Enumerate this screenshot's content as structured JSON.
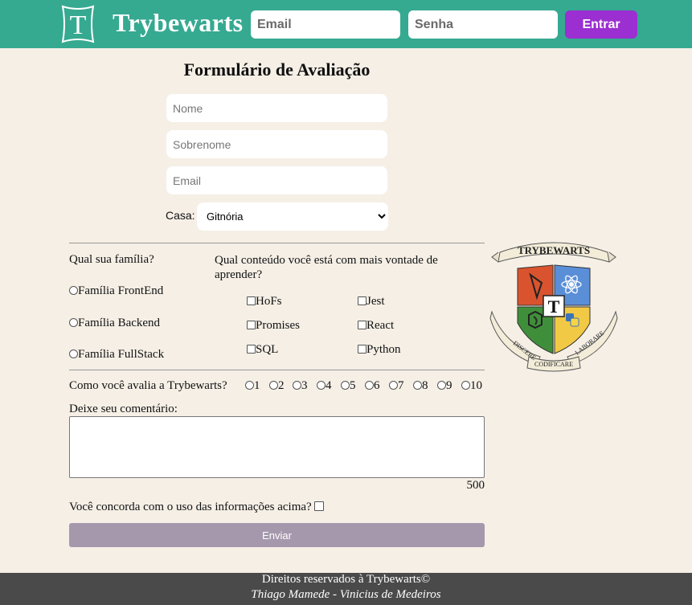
{
  "header": {
    "logo_letter": "T",
    "brand": "Trybewarts",
    "email_placeholder": "Email",
    "password_placeholder": "Senha",
    "login_button": "Entrar"
  },
  "form": {
    "title": "Formulário de Avaliação",
    "name_placeholder": "Nome",
    "lastname_placeholder": "Sobrenome",
    "email_placeholder": "Email",
    "house_label": "Casa:",
    "house_selected": "Gitnória",
    "family_question": "Qual sua família?",
    "families": [
      "Família FrontEnd",
      "Família Backend",
      "Família FullStack"
    ],
    "content_question": "Qual conteúdo você está com mais vontade de aprender?",
    "contents": [
      "HoFs",
      "Jest",
      "Promises",
      "React",
      "SQL",
      "Python"
    ],
    "rating_question": "Como você avalia a Trybewarts?",
    "ratings": [
      "1",
      "2",
      "3",
      "4",
      "5",
      "6",
      "7",
      "8",
      "9",
      "10"
    ],
    "comment_label": "Deixe seu comentário:",
    "counter": "500",
    "agreement": "Você concorda com o uso das informações acima?",
    "submit": "Enviar"
  },
  "crest": {
    "banner": "TRYBEWARTS",
    "center_letter": "T",
    "motto_left": "DISCERE",
    "motto_center": "CODIFICARE",
    "motto_right": "LABORARE"
  },
  "footer": {
    "rights": "Direitos reservados à Trybewarts©",
    "authors": "Thiago Mamede - Vinicius de Medeiros"
  },
  "colors": {
    "header": "#36a991",
    "button": "#9b2fd1",
    "submit": "#a598ad",
    "background": "#f5efe6",
    "footer": "#4a4a4a"
  }
}
